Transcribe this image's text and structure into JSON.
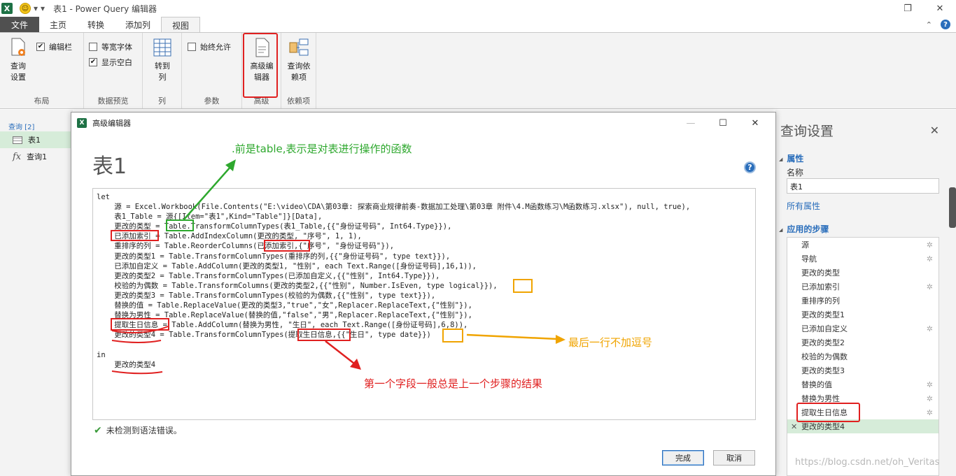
{
  "titlebar": {
    "logo": "X",
    "title": "表1 - Power Query 编辑器",
    "restore": "❐",
    "close": "✕"
  },
  "tabs": [
    "文件",
    "主页",
    "转换",
    "添加列",
    "视图"
  ],
  "tabs_right": {
    "chevron": "⌃",
    "help": "?"
  },
  "ribbon": {
    "query_settings": "查询\n设置",
    "formula_bar": "编辑栏",
    "layout_label": "布局",
    "monospace": "等宽字体",
    "show_whitespace": "显示空白",
    "data_preview_label": "数据预览",
    "goto_column": "转到\n列",
    "column_label": "列",
    "always_allow": "始终允许",
    "params_label": "参数",
    "advanced_editor": "高级编\n辑器",
    "advanced_label": "高级",
    "query_deps": "查询依\n赖项",
    "deps_label": "依赖项",
    "checked": "✔"
  },
  "left_pane": {
    "header": "查询 [2]",
    "items": [
      "表1",
      "查询1"
    ],
    "fx": "fx"
  },
  "dialog": {
    "title": "高级编辑器",
    "heading": "表1",
    "help": "?",
    "maximize": "☐",
    "minimize": "—",
    "close": "✕",
    "code": "let\n    源 = Excel.Workbook(File.Contents(\"E:\\video\\CDA\\第03章: 探索商业规律前奏-数据加工处理\\第03章 附件\\4.M函数练习\\M函数练习.xlsx\"), null, true),\n    表1_Table = 源{[Item=\"表1\",Kind=\"Table\"]}[Data],\n    更改的类型 = Table.TransformColumnTypes(表1_Table,{{\"身份证号码\", Int64.Type}}),\n    已添加索引 = Table.AddIndexColumn(更改的类型, \"序号\", 1, 1),\n    重排序的列 = Table.ReorderColumns(已添加索引,{\"序号\", \"身份证号码\"}),\n    更改的类型1 = Table.TransformColumnTypes(重排序的列,{{\"身份证号码\", type text}}),\n    已添加自定义 = Table.AddColumn(更改的类型1, \"性别\", each Text.Range([身份证号码],16,1)),\n    更改的类型2 = Table.TransformColumnTypes(已添加自定义,{{\"性别\", Int64.Type}}),\n    校验的为偶数 = Table.TransformColumns(更改的类型2,{{\"性别\", Number.IsEven, type logical}}),\n    更改的类型3 = Table.TransformColumnTypes(校验的为偶数,{{\"性别\", type text}}),\n    替换的值 = Table.ReplaceValue(更改的类型3,\"true\",\"女\",Replacer.ReplaceText,{\"性别\"}),\n    替换为男性 = Table.ReplaceValue(替换的值,\"false\",\"男\",Replacer.ReplaceText,{\"性别\"}),\n    提取生日信息 = Table.AddColumn(替换为男性, \"生日\", each Text.Range([身份证号码],6,8)),\n    更改的类型4 = Table.TransformColumnTypes(提取生日信息,{{\"生日\", type date}})\n\nin\n    更改的类型4",
    "status": "未检测到语法错误。",
    "ok": "完成",
    "cancel": "取消"
  },
  "right_pane": {
    "title": "查询设置",
    "close": "✕",
    "properties": "属性",
    "name_label": "名称",
    "name_value": "表1",
    "all_properties": "所有属性",
    "applied_steps": "应用的步骤",
    "steps": [
      {
        "label": "源",
        "gear": true
      },
      {
        "label": "导航",
        "gear": true
      },
      {
        "label": "更改的类型",
        "gear": false
      },
      {
        "label": "已添加索引",
        "gear": true
      },
      {
        "label": "重排序的列",
        "gear": false
      },
      {
        "label": "更改的类型1",
        "gear": false
      },
      {
        "label": "已添加自定义",
        "gear": true
      },
      {
        "label": "更改的类型2",
        "gear": false
      },
      {
        "label": "校验的为偶数",
        "gear": false
      },
      {
        "label": "更改的类型3",
        "gear": false
      },
      {
        "label": "替换的值",
        "gear": true
      },
      {
        "label": "替换为男性",
        "gear": true
      },
      {
        "label": "提取生日信息",
        "gear": true
      },
      {
        "label": "更改的类型4",
        "gear": false
      }
    ],
    "gear_glyph": "✲",
    "delete_glyph": "✕"
  },
  "annotations": {
    "green": ".前是table,表示是对表进行操作的函数",
    "orange": "最后一行不加逗号",
    "red": "第一个字段一般总是上一个步骤的结果"
  },
  "watermark": "https://blog.csdn.net/oh_Veritas",
  "colors": {
    "accent": "#2a6ebb",
    "selected": "#d6ecd9",
    "annotation_red": "#e02020",
    "annotation_green": "#2ea82e",
    "annotation_orange": "#f0a400"
  }
}
